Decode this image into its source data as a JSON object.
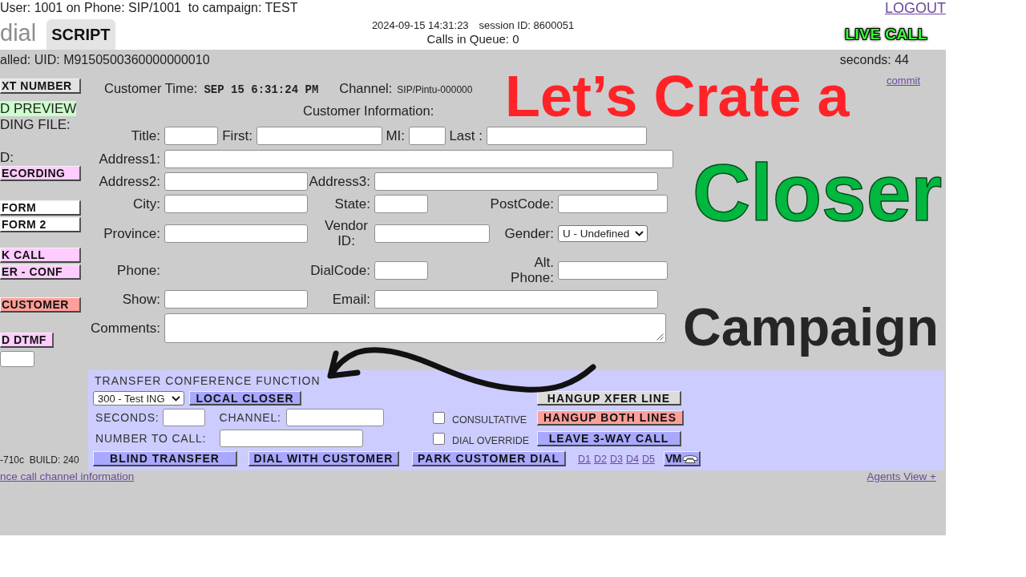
{
  "top_bar": {
    "user_line": "User: 1001 on Phone: SIP/1001  to campaign: TEST",
    "logout": "LOGOUT",
    "logo_text": "dial",
    "script_tab": {
      "label": "SCRIPT",
      "selected": true
    },
    "timestamp": "2024-09-15 14:31:23",
    "session": "session ID: 8600051",
    "queue": "Calls in Queue: 0",
    "live_status": "LIVE CALL"
  },
  "call_info": {
    "uid": "alled: UID: M9150500360000000010",
    "seconds": "seconds: 44",
    "commit": "commit"
  },
  "left_panel": [
    {
      "kind": "button",
      "label": "XT NUMBER",
      "color": "#e2e2e2"
    },
    {
      "kind": "text",
      "label": "D PREVIEW",
      "highlighted": true
    },
    {
      "kind": "text",
      "label": "DING FILE:",
      "highlighted": false
    },
    {
      "kind": "text",
      "label": "D:",
      "highlighted": false
    },
    {
      "kind": "button",
      "label": "ECORDING",
      "color": "#ffccff"
    },
    {
      "kind": "button",
      "label": "FORM",
      "color": "#ffffff"
    },
    {
      "kind": "button",
      "label": "FORM 2",
      "color": "#ffffff"
    },
    {
      "kind": "button",
      "label": "K CALL",
      "color": "#ffccff"
    },
    {
      "kind": "button",
      "label": "ER - CONF",
      "color": "#ffccff"
    },
    {
      "kind": "button",
      "label": "CUSTOMER",
      "color": "#ff9f99"
    },
    {
      "kind": "button",
      "label": "D DTMF",
      "color": "#ffccff"
    },
    {
      "kind": "input"
    }
  ],
  "customer": {
    "time_label": "Customer Time:",
    "time_value": "SEP 15 6:31:24 PM",
    "channel_label": "Channel:",
    "channel_value": "SIP/Pintu-000000",
    "info_title": "Customer Information:",
    "rows": [
      [
        {
          "label": "Title:",
          "kind": "input"
        },
        {
          "label": "First:",
          "kind": "input"
        },
        {
          "label": "MI:",
          "kind": "input"
        },
        {
          "label": "Last :",
          "kind": "input"
        }
      ],
      [
        {
          "label": "Address1:",
          "kind": "input"
        }
      ],
      [
        {
          "label": "Address2:",
          "kind": "input"
        },
        {
          "label": "Address3:",
          "kind": "input"
        }
      ],
      [
        {
          "label": "City:",
          "kind": "input"
        },
        {
          "label": "State:",
          "kind": "input"
        },
        {
          "label": "PostCode:",
          "kind": "input"
        }
      ],
      [
        {
          "label": "Province:",
          "kind": "input"
        },
        {
          "label": "Vendor ID:",
          "kind": "input"
        },
        {
          "label": "Gender:",
          "kind": "select",
          "value": "U - Undefined"
        }
      ],
      [
        {
          "label": "Phone:",
          "kind": "label"
        },
        {
          "label": "DialCode:",
          "kind": "input"
        },
        {
          "label": "Alt. Phone:",
          "kind": "input"
        }
      ],
      [
        {
          "label": "Show:",
          "kind": "input"
        },
        {
          "label": "Email:",
          "kind": "input"
        }
      ],
      [
        {
          "label": "Comments:",
          "kind": "textarea"
        }
      ]
    ]
  },
  "transfer": {
    "title": "TRANSFER CONFERENCE FUNCTION",
    "group_select": "300 - Test ING",
    "local_closer": "LOCAL CLOSER",
    "seconds_label": "SECONDS:",
    "channel_label": "CHANNEL:",
    "number_label": "NUMBER TO CALL:",
    "options": [
      {
        "label": "CONSULTATIVE",
        "checked": false
      },
      {
        "label": "DIAL OVERRIDE",
        "checked": false
      }
    ],
    "line_buttons": [
      {
        "label": "HANGUP XFER LINE",
        "color": "#dcdcdc"
      },
      {
        "label": "HANGUP BOTH LINES",
        "color": "#ff9f99"
      },
      {
        "label": "LEAVE 3-WAY CALL",
        "color": "#a8a8ff"
      }
    ],
    "dial_buttons": [
      {
        "label": "BLIND TRANSFER",
        "color": "#a8a8ff"
      },
      {
        "label": "DIAL WITH CUSTOMER",
        "color": "#a8a8ff"
      },
      {
        "label": "PARK CUSTOMER DIAL",
        "color": "#a8a8ff"
      }
    ],
    "dial_links": [
      "D1",
      "D2",
      "D3",
      "D4",
      "D5"
    ],
    "voicemail": "VM"
  },
  "footer": {
    "build": "-710c  BUILD: 240",
    "channel_info": "nce call channel information",
    "agents_view": "Agents View +"
  },
  "overlay": {
    "headlines": [
      {
        "text": "Let’s Crate a",
        "color": "#ff2328"
      },
      {
        "text": "Closer",
        "color": "#00b83f"
      },
      {
        "text": "Campaign",
        "color": "#262626"
      }
    ]
  }
}
